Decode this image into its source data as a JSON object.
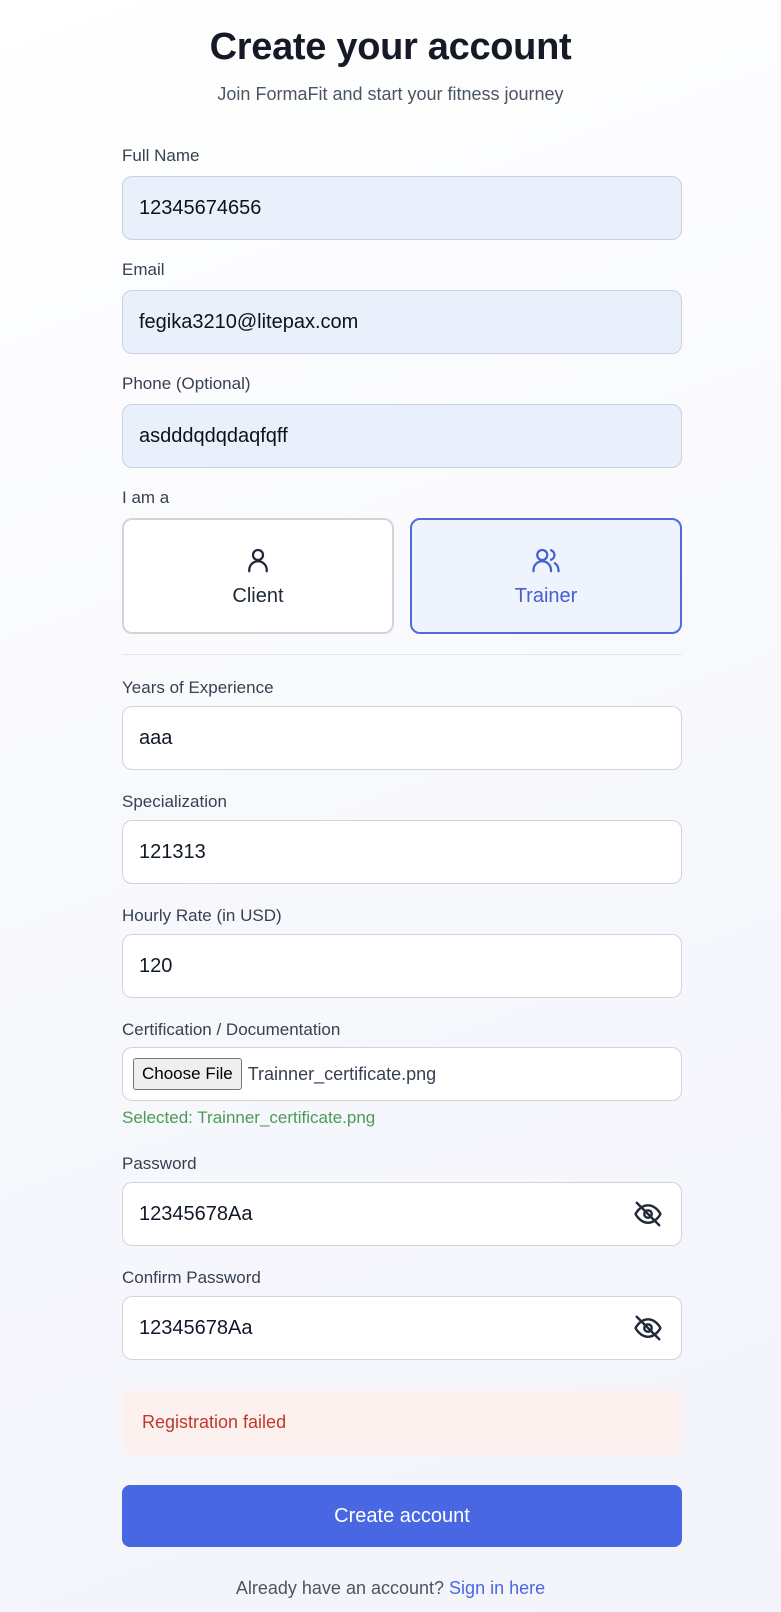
{
  "header": {
    "title": "Create your account",
    "subtitle": "Join FormaFit and start your fitness journey"
  },
  "form": {
    "full_name": {
      "label": "Full Name",
      "value": "12345674656"
    },
    "email": {
      "label": "Email",
      "value": "fegika3210@litepax.com"
    },
    "phone": {
      "label": "Phone (Optional)",
      "value": "asdddqdqdaqfqff"
    },
    "role": {
      "label": "I am a",
      "options": [
        {
          "label": "Client",
          "icon": "user-icon",
          "selected": false
        },
        {
          "label": "Trainer",
          "icon": "users-icon",
          "selected": true
        }
      ]
    },
    "experience": {
      "label": "Years of Experience",
      "value": "aaa"
    },
    "specialization": {
      "label": "Specialization",
      "value": "121313"
    },
    "hourly_rate": {
      "label": "Hourly Rate (in USD)",
      "value": "120"
    },
    "certification": {
      "label": "Certification / Documentation",
      "button_label": "Choose File",
      "file_name": "Trainner_certificate.png",
      "selected_text": "Selected: Trainner_certificate.png"
    },
    "password": {
      "label": "Password",
      "value": "12345678Aa",
      "toggle_icon": "eye-off-icon"
    },
    "confirm_password": {
      "label": "Confirm Password",
      "value": "12345678Aa",
      "toggle_icon": "eye-off-icon"
    },
    "error_message": "Registration failed",
    "submit_label": "Create account"
  },
  "footer": {
    "prompt": "Already have an account?",
    "link": "Sign in here"
  },
  "colors": {
    "accent": "#4a67e3",
    "selected_border": "#4e6cd9",
    "error_text": "#c0392b",
    "error_bg": "#fdf1f0",
    "success_text": "#4d9a55",
    "autofill_bg": "#e9f0fc"
  }
}
